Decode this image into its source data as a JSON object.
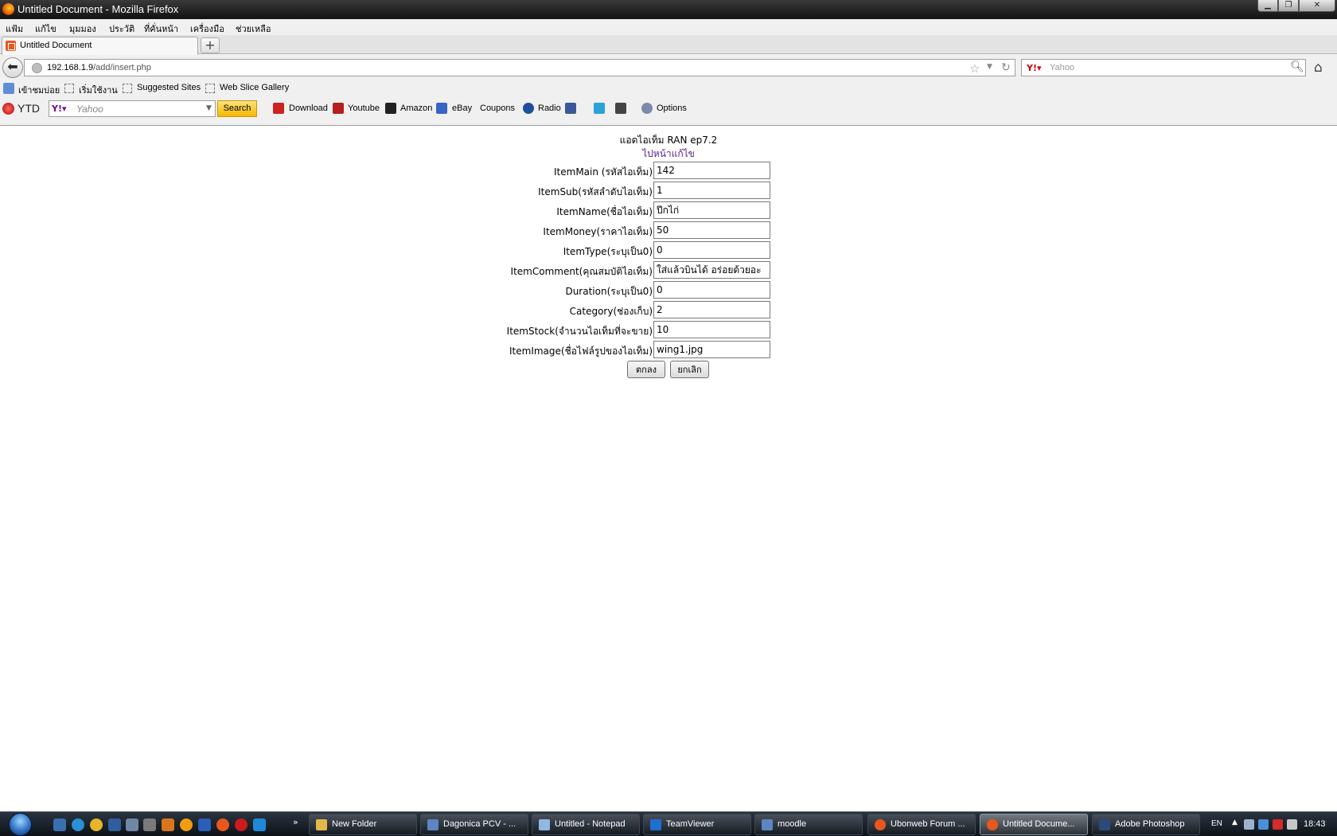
{
  "window": {
    "title": "Untitled Document - Mozilla Firefox"
  },
  "menu": [
    "แฟ้ม",
    "แก้ไข",
    "มุมมอง",
    "ประวัติ",
    "ที่คั่นหน้า",
    "เครื่องมือ",
    "ช่วยเหลือ"
  ],
  "tab": {
    "title": "Untitled Document",
    "new_tab_symbol": "+"
  },
  "nav": {
    "url_host": "192.168.1.9",
    "url_path": "/add/insert.php",
    "search_placeholder": "Yahoo"
  },
  "bookmarks": [
    "เข้าชมบ่อย",
    "เริ่มใช้งาน",
    "Suggested Sites",
    "Web Slice Gallery"
  ],
  "yahoo_toolbar": {
    "brand": "YTD",
    "search_placeholder": "Yahoo",
    "search_button": "Search",
    "items": [
      "Download",
      "Youtube",
      "Amazon",
      "eBay",
      "Coupons",
      "Radio",
      "Options"
    ]
  },
  "page": {
    "heading": "แอดไอเท็ม RAN ep7.2",
    "edit_link": "ไปหน้าแก้ไข",
    "fields": [
      {
        "label": "ItemMain (รหัสไอเท็ม)",
        "value": "142"
      },
      {
        "label": "ItemSub(รหัสลำดับไอเท็ม)",
        "value": "1"
      },
      {
        "label": "ItemName(ชื่อไอเท็ม)",
        "value": "ปีกไก่"
      },
      {
        "label": "ItemMoney(ราคาไอเท็ม)",
        "value": "50"
      },
      {
        "label": "ItemType(ระบุเป็น0)",
        "value": "0"
      },
      {
        "label": "ItemComment(คุณสมบัติไอเท็ม)",
        "value": "ใส่แล้วบินได้ อร่อยด้วยอะ"
      },
      {
        "label": "Duration(ระบุเป็น0)",
        "value": "0"
      },
      {
        "label": "Category(ช่องเก็บ)",
        "value": "2"
      },
      {
        "label": "ItemStock(จำนวนไอเท็มที่จะขาย)",
        "value": "10"
      },
      {
        "label": "ItemImage(ชื่อไฟล์รูปของไอเท็ม)",
        "value": "wing1.jpg"
      }
    ],
    "ok_button": "ตกลง",
    "cancel_button": "ยกเลิก"
  },
  "taskbar": {
    "items": [
      "New Folder",
      "Dagonica PCV - ...",
      "Untitled - Notepad",
      "TeamViewer",
      "moodle",
      "Ubonweb Forum ...",
      "Untitled Docume...",
      "Adobe Photoshop"
    ],
    "active_index": 6,
    "language": "EN",
    "clock": "18:43"
  }
}
